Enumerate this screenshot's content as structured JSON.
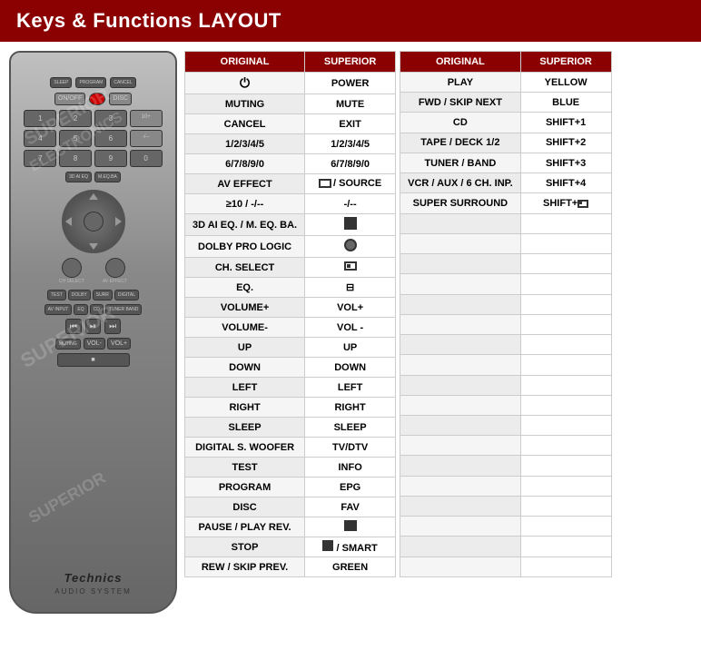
{
  "header": {
    "title": "Keys & Functions LAYOUT"
  },
  "colors": {
    "header_bg": "#8b0000",
    "header_text": "#ffffff",
    "col_original_bg": "#8b0000",
    "col_superior_bg": "#8b0000",
    "row_odd": "#ffffff",
    "row_even": "#f9f9f9"
  },
  "left_table": {
    "col1_header": "ORIGINAL",
    "col2_header": "SUPERIOR",
    "rows": [
      {
        "original": "⏻",
        "superior": "POWER",
        "is_icon": true
      },
      {
        "original": "MUTING",
        "superior": "MUTE"
      },
      {
        "original": "CANCEL",
        "superior": "EXIT"
      },
      {
        "original": "1/2/3/4/5",
        "superior": "1/2/3/4/5"
      },
      {
        "original": "6/7/8/9/0",
        "superior": "6/7/8/9/0"
      },
      {
        "original": "AV EFFECT",
        "superior": "⊟ / SOURCE",
        "superior_icon": true
      },
      {
        "original": "≥10 / -/--",
        "superior": "-/--"
      },
      {
        "original": "3D AI EQ. / M. EQ. BA.",
        "superior": "🔳",
        "superior_icon": true
      },
      {
        "original": "DOLBY PRO LOGIC",
        "superior": "⊙",
        "superior_icon": true
      },
      {
        "original": "CH. SELECT",
        "superior": "⊡",
        "superior_icon": true
      },
      {
        "original": "EQ.",
        "superior": "⊟",
        "superior_icon": true
      },
      {
        "original": "VOLUME+",
        "superior": "VOL+"
      },
      {
        "original": "VOLUME-",
        "superior": "VOL -"
      },
      {
        "original": "UP",
        "superior": "UP"
      },
      {
        "original": "DOWN",
        "superior": "DOWN"
      },
      {
        "original": "LEFT",
        "superior": "LEFT"
      },
      {
        "original": "RIGHT",
        "superior": "RIGHT"
      },
      {
        "original": "SLEEP",
        "superior": "SLEEP"
      },
      {
        "original": "DIGITAL S. WOOFER",
        "superior": "TV/DTV"
      },
      {
        "original": "TEST",
        "superior": "INFO"
      },
      {
        "original": "PROGRAM",
        "superior": "EPG"
      },
      {
        "original": "DISC",
        "superior": "FAV"
      },
      {
        "original": "PAUSE / PLAY REV.",
        "superior": "⏸",
        "superior_icon": true
      },
      {
        "original": "STOP",
        "superior": "⏹ / SMART",
        "superior_icon": true
      },
      {
        "original": "REW / SKIP PREV.",
        "superior": "GREEN"
      }
    ]
  },
  "right_table": {
    "col1_header": "ORIGINAL",
    "col2_header": "SUPERIOR",
    "rows": [
      {
        "original": "PLAY",
        "superior": "YELLOW"
      },
      {
        "original": "FWD / SKIP NEXT",
        "superior": "BLUE"
      },
      {
        "original": "CD",
        "superior": "SHIFT+1"
      },
      {
        "original": "TAPE / DECK 1/2",
        "superior": "SHIFT+2"
      },
      {
        "original": "TUNER / BAND",
        "superior": "SHIFT+3"
      },
      {
        "original": "VCR / AUX / 6 CH. INP.",
        "superior": "SHIFT+4"
      },
      {
        "original": "SUPER SURROUND",
        "superior": "SHIFT+⊡",
        "superior_icon": true
      },
      {
        "original": "",
        "superior": ""
      },
      {
        "original": "",
        "superior": ""
      },
      {
        "original": "",
        "superior": ""
      },
      {
        "original": "",
        "superior": ""
      },
      {
        "original": "",
        "superior": ""
      },
      {
        "original": "",
        "superior": ""
      },
      {
        "original": "",
        "superior": ""
      },
      {
        "original": "",
        "superior": ""
      },
      {
        "original": "",
        "superior": ""
      },
      {
        "original": "",
        "superior": ""
      },
      {
        "original": "",
        "superior": ""
      },
      {
        "original": "",
        "superior": ""
      },
      {
        "original": "",
        "superior": ""
      },
      {
        "original": "",
        "superior": ""
      },
      {
        "original": "",
        "superior": ""
      },
      {
        "original": "",
        "superior": ""
      },
      {
        "original": "",
        "superior": ""
      },
      {
        "original": "",
        "superior": ""
      }
    ]
  },
  "remote": {
    "brand": "Technics",
    "sub": "AUDIO SYSTEM",
    "watermark1": "SUPERIOR",
    "watermark2": "ELECTRONICS"
  }
}
